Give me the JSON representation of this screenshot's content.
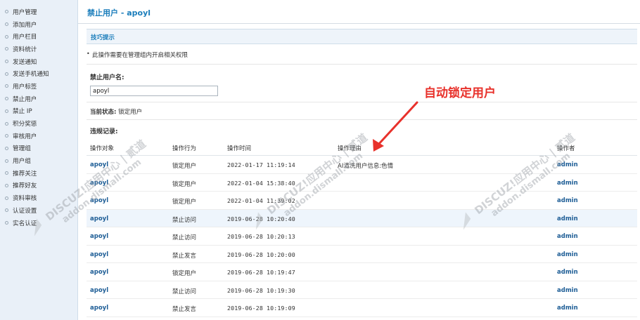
{
  "sidebar": {
    "items": [
      {
        "label": "用户管理"
      },
      {
        "label": "添加用户"
      },
      {
        "label": "用户栏目"
      },
      {
        "label": "资料统计"
      },
      {
        "label": "发送通知"
      },
      {
        "label": "发送手机通知"
      },
      {
        "label": "用户标签"
      },
      {
        "label": "禁止用户"
      },
      {
        "label": "禁止 IP"
      },
      {
        "label": "积分奖惩"
      },
      {
        "label": "审核用户"
      },
      {
        "label": "管理组"
      },
      {
        "label": "用户组"
      },
      {
        "label": "推荐关注"
      },
      {
        "label": "推荐好友"
      },
      {
        "label": "资料审核"
      },
      {
        "label": "认证设置"
      },
      {
        "label": "实名认证"
      }
    ]
  },
  "page": {
    "title": "禁止用户 - apoyl"
  },
  "tips": {
    "title": "技巧提示",
    "bullet": "•",
    "text": "此操作需要在管理组内开启相关权限"
  },
  "form": {
    "username_label": "禁止用户名:",
    "username_value": "apoyl",
    "status_label": "当前状态:",
    "status_value": "锁定用户",
    "records_label": "违规记录:"
  },
  "table": {
    "headers": {
      "object": "操作对象",
      "action": "操作行为",
      "time": "操作时间",
      "reason": "操作理由",
      "operator": "操作者"
    },
    "rows": [
      {
        "object": "apoyl",
        "action": "锁定用户",
        "time": "2022-01-17 11:19:14",
        "reason": "AI清洗用户信息:色情",
        "operator": "admin",
        "highlight": false
      },
      {
        "object": "apoyl",
        "action": "锁定用户",
        "time": "2022-01-04 15:38:40",
        "reason": "",
        "operator": "admin",
        "highlight": false
      },
      {
        "object": "apoyl",
        "action": "锁定用户",
        "time": "2022-01-04 11:39:02",
        "reason": "",
        "operator": "admin",
        "highlight": false
      },
      {
        "object": "apoyl",
        "action": "禁止访问",
        "time": "2019-06-28 10:20:40",
        "reason": "",
        "operator": "admin",
        "highlight": true
      },
      {
        "object": "apoyl",
        "action": "禁止访问",
        "time": "2019-06-28 10:20:13",
        "reason": "",
        "operator": "admin",
        "highlight": false
      },
      {
        "object": "apoyl",
        "action": "禁止发言",
        "time": "2019-06-28 10:20:00",
        "reason": "",
        "operator": "admin",
        "highlight": false
      },
      {
        "object": "apoyl",
        "action": "锁定用户",
        "time": "2019-06-28 10:19:47",
        "reason": "",
        "operator": "admin",
        "highlight": false
      },
      {
        "object": "apoyl",
        "action": "禁止访问",
        "time": "2019-06-28 10:19:30",
        "reason": "",
        "operator": "admin",
        "highlight": false
      },
      {
        "object": "apoyl",
        "action": "禁止发言",
        "time": "2019-06-28 10:19:09",
        "reason": "",
        "operator": "admin",
        "highlight": false
      }
    ]
  },
  "annotation": {
    "text": "自动锁定用户",
    "color": "#e8312b"
  },
  "watermark": {
    "line1": "DISCUZ!应用中心 | 贰道",
    "line2": "addon.dismall.com"
  },
  "colors": {
    "title": "#1a7dbb",
    "link": "#1c5c95",
    "sidebar_bg": "#e9f0f8",
    "highlight_row": "#eef5fc"
  }
}
